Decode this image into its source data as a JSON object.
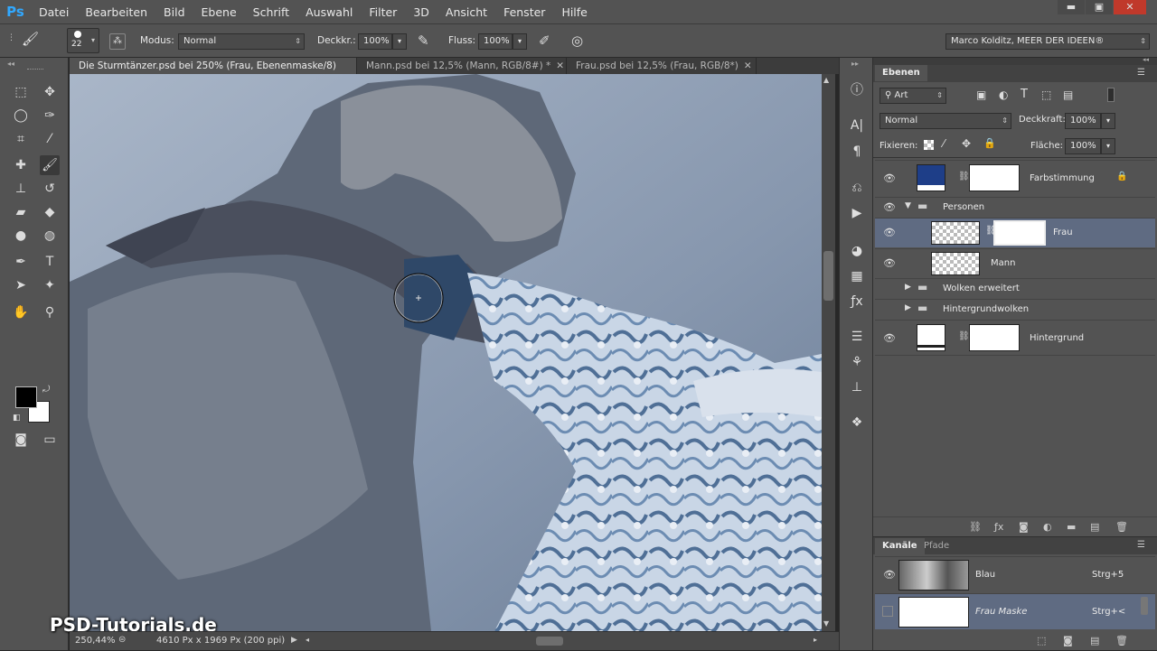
{
  "app": {
    "logo": "Ps"
  },
  "menu": [
    "Datei",
    "Bearbeiten",
    "Bild",
    "Ebene",
    "Schrift",
    "Auswahl",
    "Filter",
    "3D",
    "Ansicht",
    "Fenster",
    "Hilfe"
  ],
  "window_controls": {
    "minimize": "▬",
    "restore": "▣",
    "close": "✕"
  },
  "options": {
    "brush_size": "22",
    "modus_label": "Modus:",
    "modus_value": "Normal",
    "deckkraft_label": "Deckkr.:",
    "deckkraft_value": "100%",
    "fluss_label": "Fluss:",
    "fluss_value": "100%",
    "workspace": "Marco Kolditz, MEER DER IDEEN®"
  },
  "tabs": [
    {
      "label": "Die Sturmtänzer.psd bei 250% (Frau, Ebenenmaske/8) *",
      "close": "✕"
    },
    {
      "label": "Mann.psd bei 12,5% (Mann, RGB/8#) *",
      "close": "✕"
    },
    {
      "label": "Frau.psd bei 12,5% (Frau, RGB/8*)",
      "close": "✕"
    }
  ],
  "status": {
    "zoom": "250,44%",
    "doc_info": "4610 Px x 1969 Px (200 ppi)"
  },
  "watermark": "PSD-Tutorials.de",
  "layers_panel": {
    "tab": "Ebenen",
    "filter_kind": "Art",
    "blend_mode": "Normal",
    "opacity_label": "Deckkraft:",
    "opacity_value": "100%",
    "lock_label": "Fixieren:",
    "fill_label": "Fläche:",
    "fill_value": "100%",
    "layers": [
      {
        "name": "Farbstimmung"
      },
      {
        "name": "Personen"
      },
      {
        "name": "Frau"
      },
      {
        "name": "Mann"
      },
      {
        "name": "Wolken erweitert"
      },
      {
        "name": "Hintergrundwolken"
      },
      {
        "name": "Hintergrund"
      }
    ]
  },
  "channels_panel": {
    "tabs": [
      "Kanäle",
      "Pfade"
    ],
    "channels": [
      {
        "name": "Blau",
        "shortcut": "Strg+5"
      },
      {
        "name": "Frau Maske",
        "shortcut": "Strg+<"
      }
    ]
  },
  "colors": {
    "accent": "#31a8ff",
    "selected_row": "#5f6b82",
    "panel_bg": "#535353"
  }
}
